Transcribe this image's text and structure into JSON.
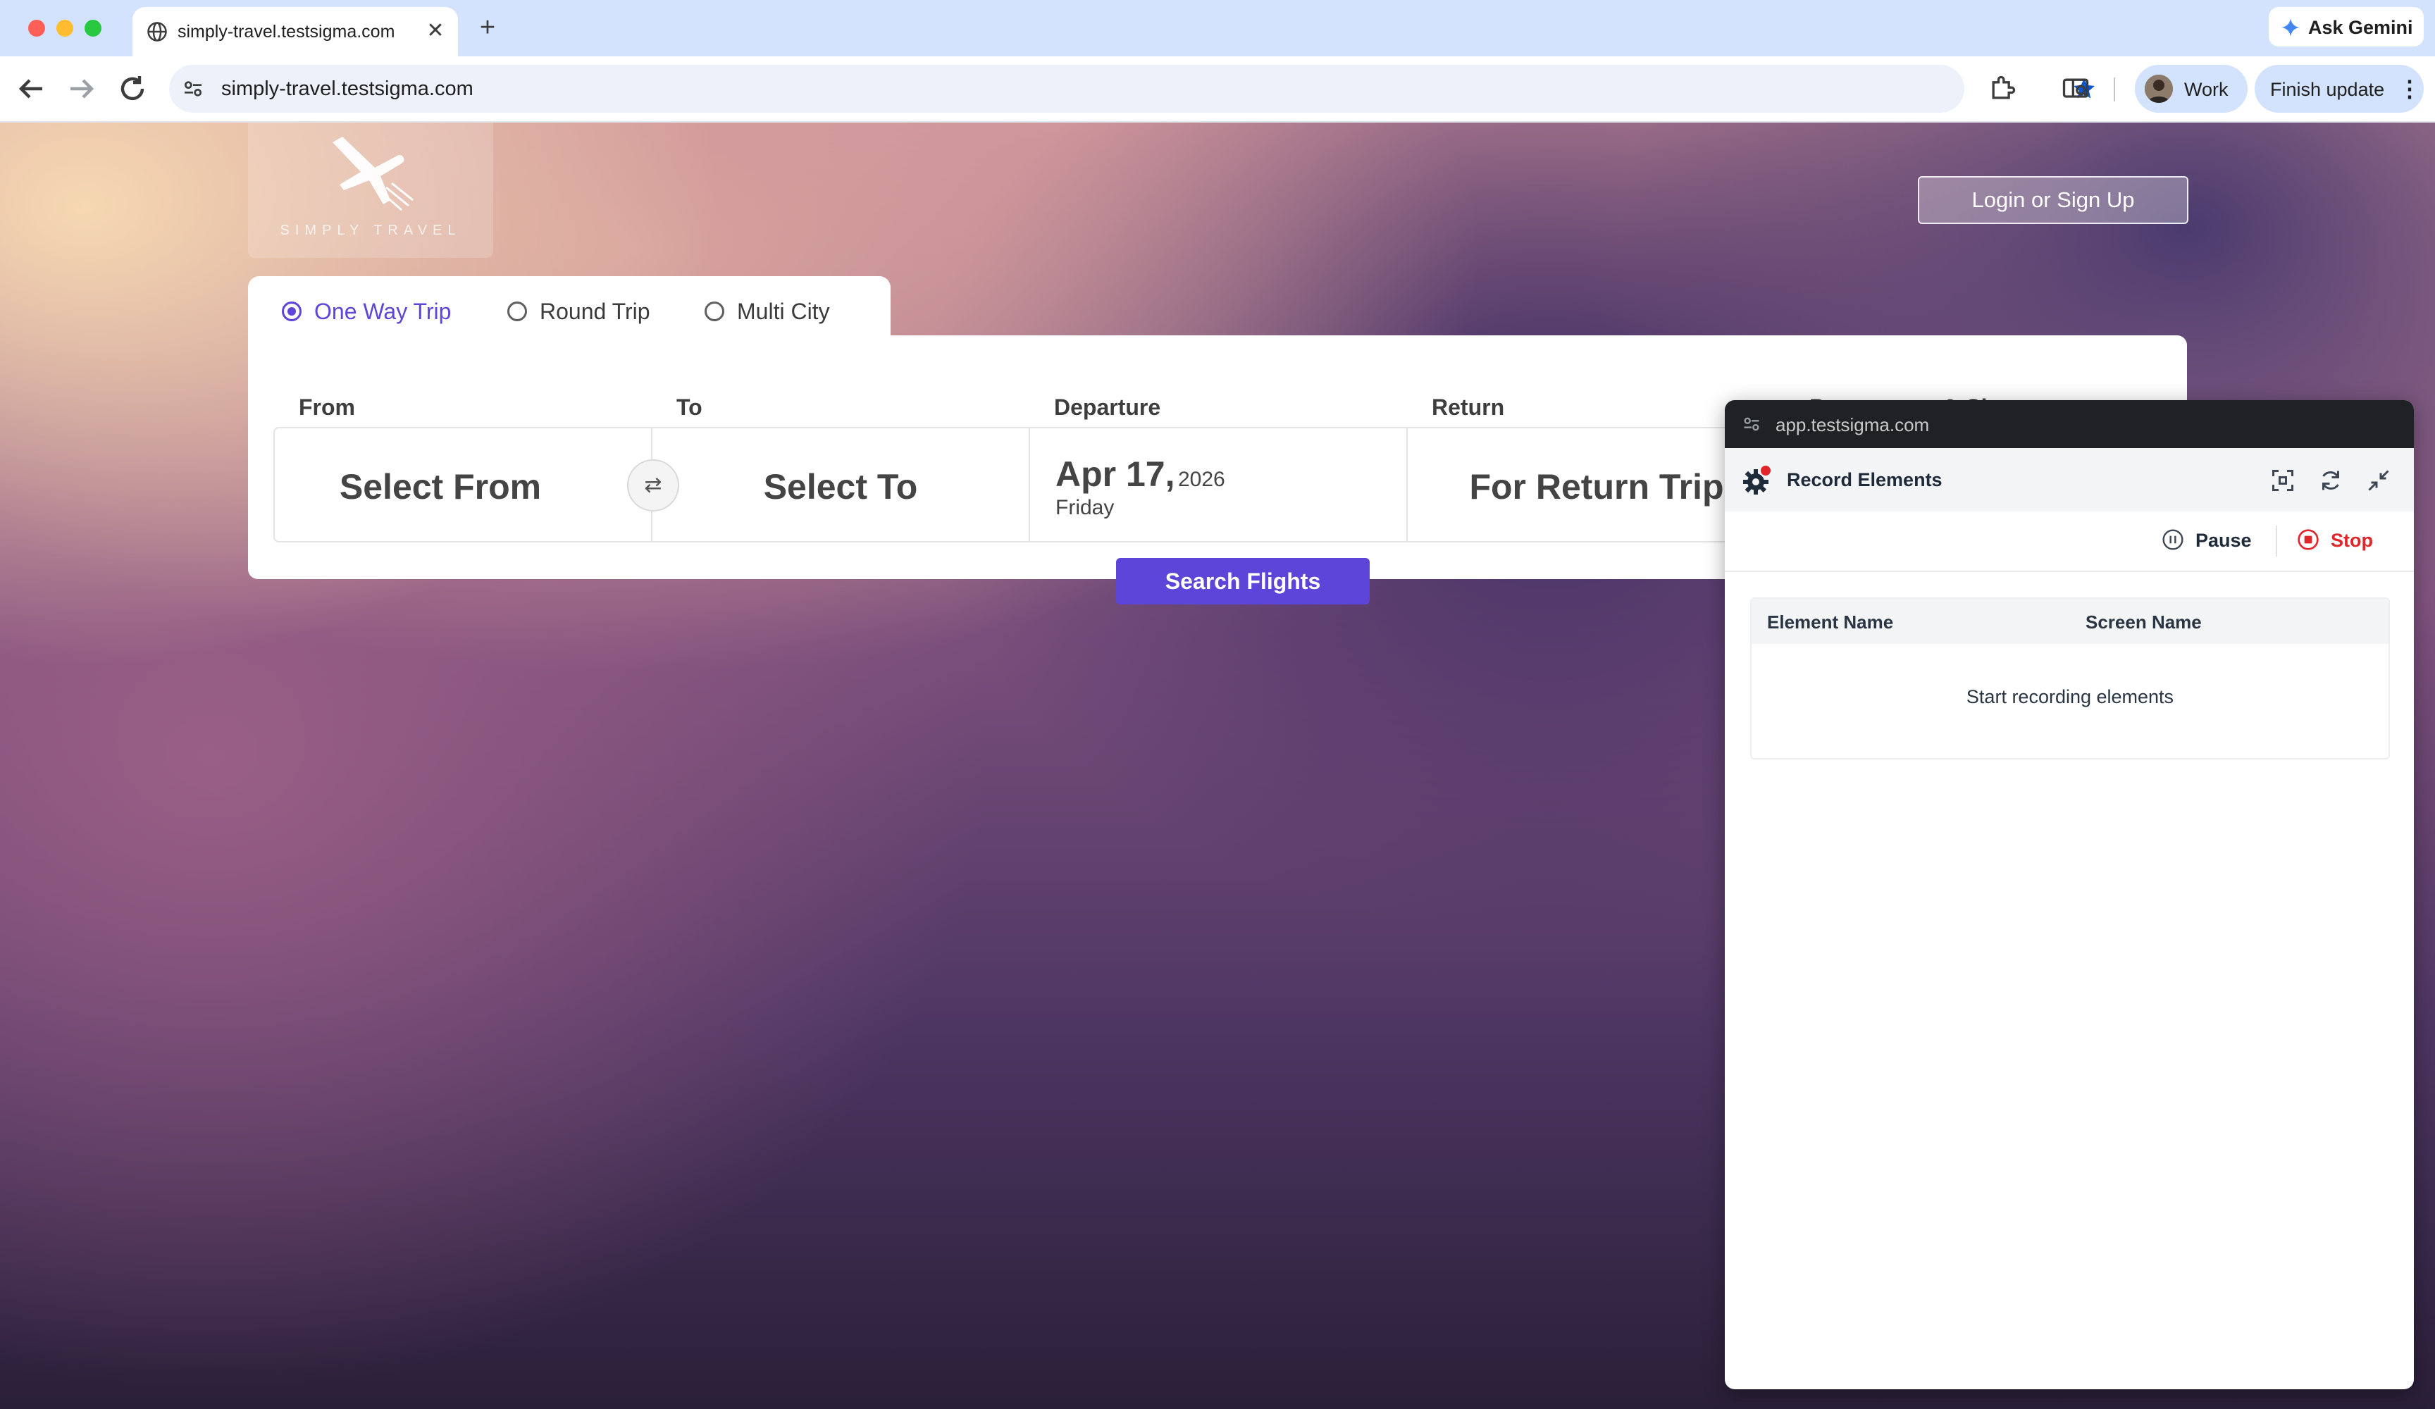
{
  "browser": {
    "tab_title": "simply-travel.testsigma.com",
    "close_glyph": "✕",
    "new_tab_glyph": "+",
    "ask_gemini": "Ask Gemini",
    "url": "simply-travel.testsigma.com",
    "profile_label": "Work",
    "update_label": "Finish update",
    "kebab_glyph": "⋮",
    "icons": [
      "globe-icon",
      "gemini-icon",
      "back-icon",
      "forward-icon",
      "reload-icon",
      "site-info-icon",
      "bookmark-star-icon",
      "extensions-icon",
      "reading-mode-icon"
    ]
  },
  "page": {
    "logo_text": "SIMPLY TRAVEL",
    "login_button": "Login or Sign Up",
    "trip_types": [
      {
        "label": "One Way Trip",
        "selected": true
      },
      {
        "label": "Round Trip",
        "selected": false
      },
      {
        "label": "Multi City",
        "selected": false
      }
    ],
    "fields": {
      "from_label": "From",
      "to_label": "To",
      "departure_label": "Departure",
      "return_label": "Return",
      "passengers_label": "Passengers & Class",
      "from_value": "Select From",
      "to_value": "Select To",
      "swap_glyph": "⇄",
      "departure_date": "Apr 17,",
      "departure_year": "2026",
      "departure_day": "Friday",
      "return_value": "For Return Trip"
    },
    "search_button": "Search Flights",
    "accent_color": "#5c45d8"
  },
  "recorder": {
    "url": "app.testsigma.com",
    "title": "Record Elements",
    "pause_label": "Pause",
    "stop_label": "Stop",
    "columns": [
      "Element Name",
      "Screen Name"
    ],
    "empty_message": "Start recording elements",
    "stop_color": "#e0262b"
  }
}
